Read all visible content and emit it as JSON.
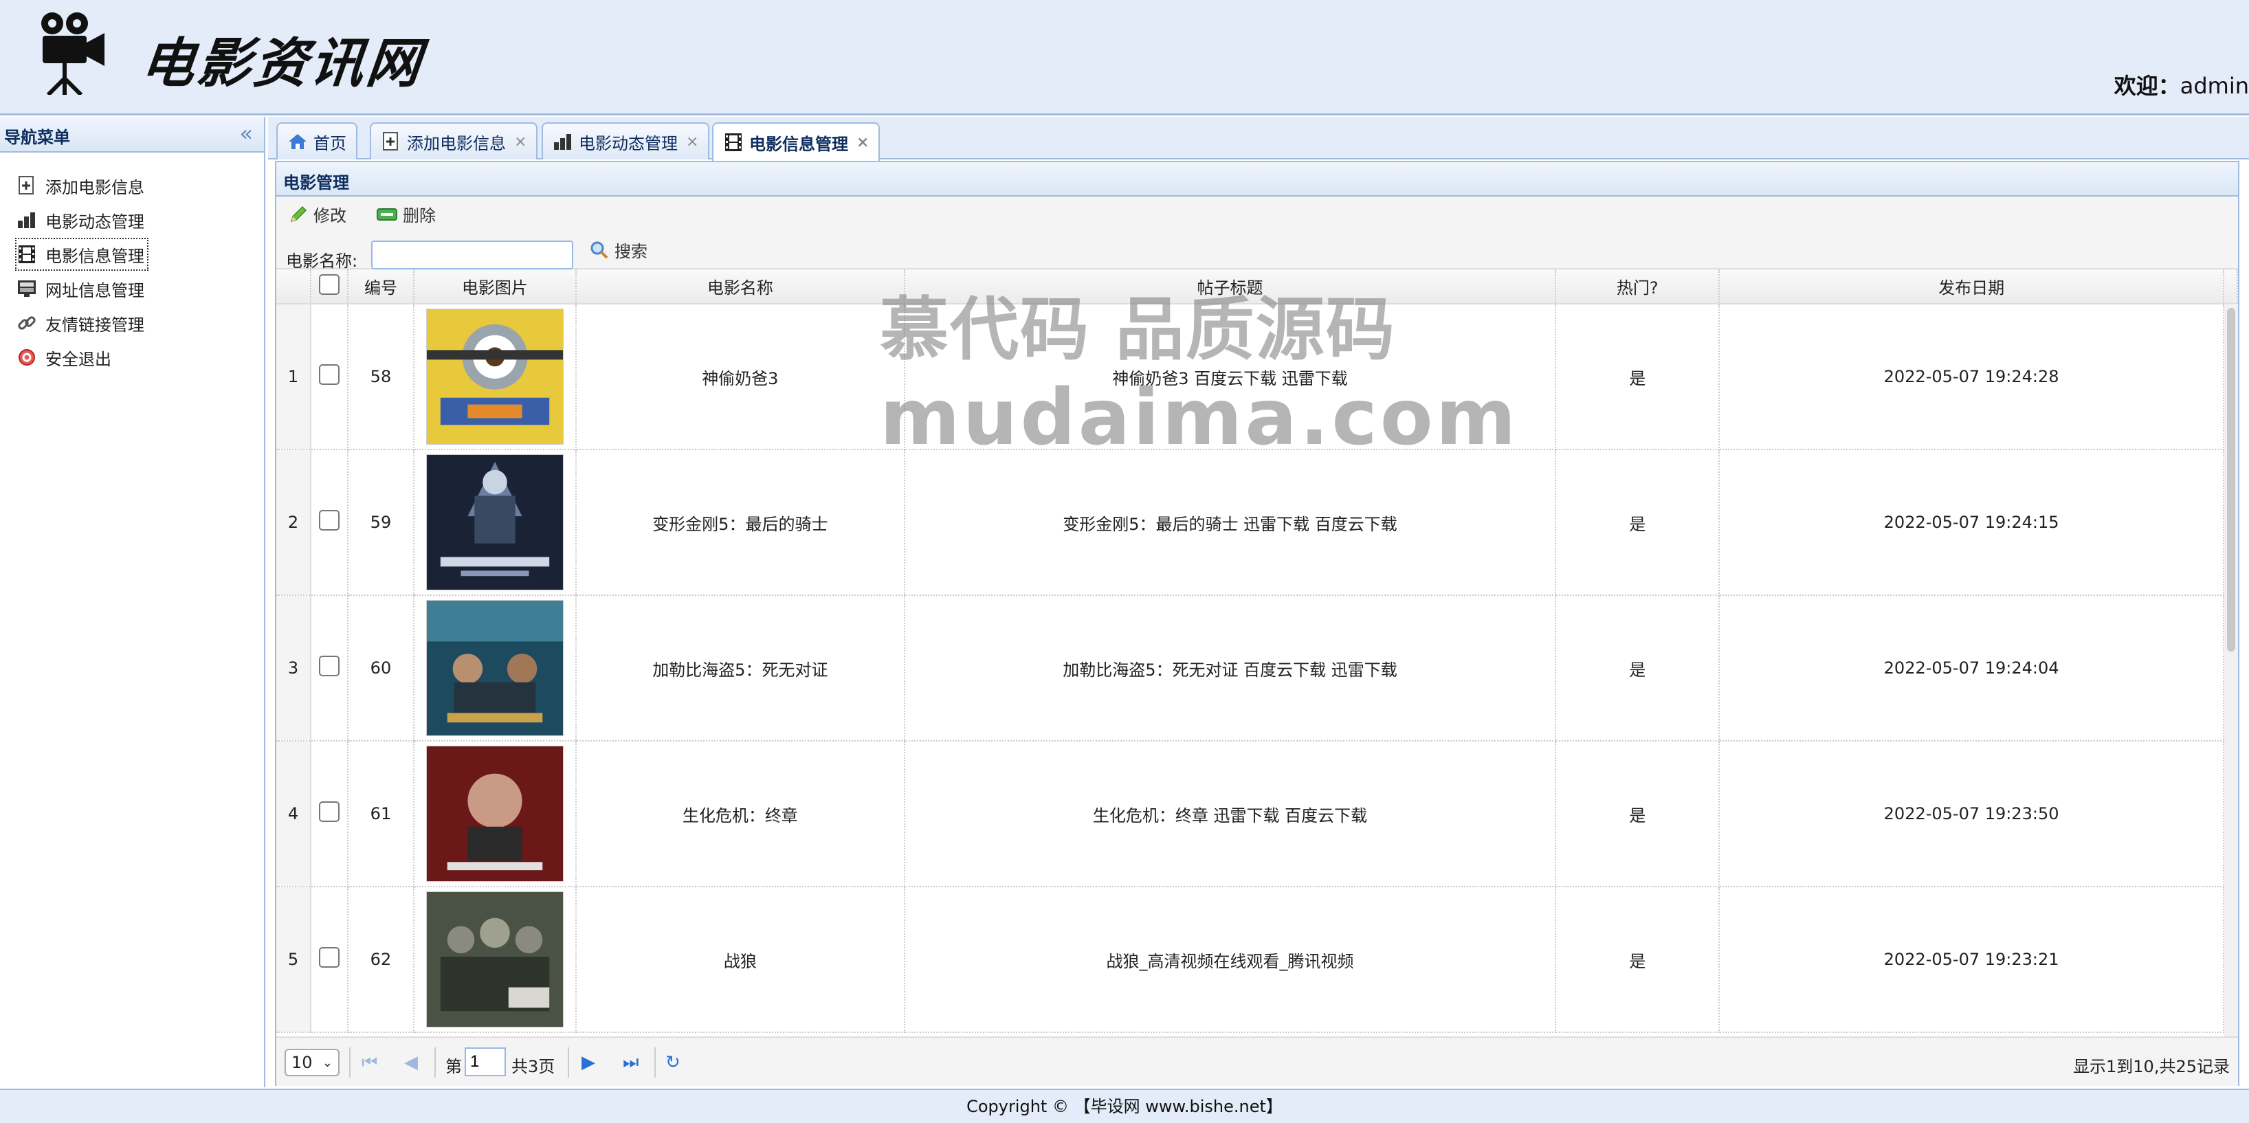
{
  "header": {
    "logo_text": "电影资讯网",
    "welcome_label": "欢迎：",
    "welcome_user": "admin"
  },
  "sidebar": {
    "title": "导航菜单",
    "items": [
      {
        "label": "添加电影信息",
        "icon": "add-doc-icon"
      },
      {
        "label": "电影动态管理",
        "icon": "bar-chart-icon"
      },
      {
        "label": "电影信息管理",
        "icon": "film-icon"
      },
      {
        "label": "网址信息管理",
        "icon": "monitor-icon"
      },
      {
        "label": "友情链接管理",
        "icon": "link-icon"
      },
      {
        "label": "安全退出",
        "icon": "exit-icon"
      }
    ]
  },
  "tabs": [
    {
      "label": "首页",
      "icon": "home-icon"
    },
    {
      "label": "添加电影信息",
      "icon": "add-doc-icon"
    },
    {
      "label": "电影动态管理",
      "icon": "bar-chart-icon"
    },
    {
      "label": "电影信息管理",
      "icon": "film-icon"
    }
  ],
  "panel": {
    "title": "电影管理",
    "edit_label": "修改",
    "delete_label": "删除",
    "search_label": "电影名称:",
    "search_value": "",
    "search_button": "搜索"
  },
  "grid": {
    "columns": [
      "编号",
      "电影图片",
      "电影名称",
      "帖子标题",
      "热门?",
      "发布日期"
    ],
    "rows": [
      {
        "rn": "1",
        "id": "58",
        "name": "神偷奶爸3",
        "title": "神偷奶爸3 百度云下载 迅雷下载",
        "hot": "是",
        "date": "2022-05-07 19:24:28"
      },
      {
        "rn": "2",
        "id": "59",
        "name": "变形金刚5：最后的骑士",
        "title": "变形金刚5：最后的骑士 迅雷下载 百度云下载",
        "hot": "是",
        "date": "2022-05-07 19:24:15"
      },
      {
        "rn": "3",
        "id": "60",
        "name": "加勒比海盗5：死无对证",
        "title": "加勒比海盗5：死无对证 百度云下载 迅雷下载",
        "hot": "是",
        "date": "2022-05-07 19:24:04"
      },
      {
        "rn": "4",
        "id": "61",
        "name": "生化危机：终章",
        "title": "生化危机：终章 迅雷下载 百度云下载",
        "hot": "是",
        "date": "2022-05-07 19:23:50"
      },
      {
        "rn": "5",
        "id": "62",
        "name": "战狼",
        "title": "战狼_高清视频在线观看_腾讯视频",
        "hot": "是",
        "date": "2022-05-07 19:23:21"
      }
    ]
  },
  "pager": {
    "page_size": "10",
    "page_prefix": "第",
    "page_value": "1",
    "page_total": "共3页",
    "info": "显示1到10,共25记录"
  },
  "footer": {
    "text": "Copyright © 【毕设网 www.bishe.net】"
  },
  "watermark": {
    "line1": "慕代码 品质源码",
    "line2": "mudaima.com"
  },
  "colors": {
    "header_bg": "#e3ecf8",
    "border": "#9fbbe0",
    "title_blue": "#0e2d5f",
    "pager_blue": "#2a6fd6"
  }
}
